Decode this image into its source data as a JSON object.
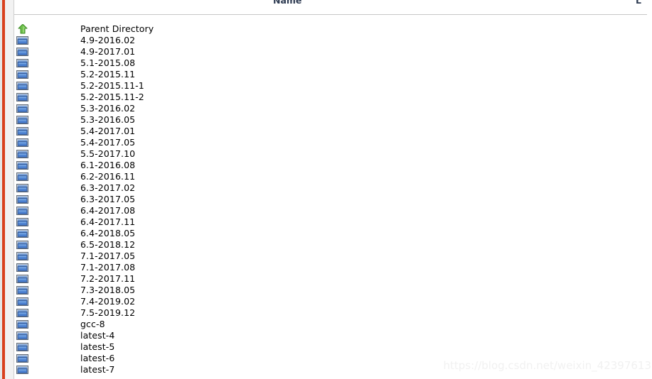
{
  "page": {
    "background_color": "#ffffff",
    "text_color": "#2f3640",
    "accent_color": "#d9411e",
    "rule_color": "#c6c6c6"
  },
  "columns": {
    "name_label": "Name",
    "last_modified_label": "L"
  },
  "listing": {
    "entries": [
      {
        "icon": "parent-directory-icon",
        "name": "Parent Directory"
      },
      {
        "icon": "folder-icon",
        "name": "4.9-2016.02"
      },
      {
        "icon": "folder-icon",
        "name": "4.9-2017.01"
      },
      {
        "icon": "folder-icon",
        "name": "5.1-2015.08"
      },
      {
        "icon": "folder-icon",
        "name": "5.2-2015.11"
      },
      {
        "icon": "folder-icon",
        "name": "5.2-2015.11-1"
      },
      {
        "icon": "folder-icon",
        "name": "5.2-2015.11-2"
      },
      {
        "icon": "folder-icon",
        "name": "5.3-2016.02"
      },
      {
        "icon": "folder-icon",
        "name": "5.3-2016.05"
      },
      {
        "icon": "folder-icon",
        "name": "5.4-2017.01"
      },
      {
        "icon": "folder-icon",
        "name": "5.4-2017.05"
      },
      {
        "icon": "folder-icon",
        "name": "5.5-2017.10"
      },
      {
        "icon": "folder-icon",
        "name": "6.1-2016.08"
      },
      {
        "icon": "folder-icon",
        "name": "6.2-2016.11"
      },
      {
        "icon": "folder-icon",
        "name": "6.3-2017.02"
      },
      {
        "icon": "folder-icon",
        "name": "6.3-2017.05"
      },
      {
        "icon": "folder-icon",
        "name": "6.4-2017.08"
      },
      {
        "icon": "folder-icon",
        "name": "6.4-2017.11"
      },
      {
        "icon": "folder-icon",
        "name": "6.4-2018.05"
      },
      {
        "icon": "folder-icon",
        "name": "6.5-2018.12"
      },
      {
        "icon": "folder-icon",
        "name": "7.1-2017.05"
      },
      {
        "icon": "folder-icon",
        "name": "7.1-2017.08"
      },
      {
        "icon": "folder-icon",
        "name": "7.2-2017.11"
      },
      {
        "icon": "folder-icon",
        "name": "7.3-2018.05"
      },
      {
        "icon": "folder-icon",
        "name": "7.4-2019.02"
      },
      {
        "icon": "folder-icon",
        "name": "7.5-2019.12"
      },
      {
        "icon": "folder-icon",
        "name": "gcc-8"
      },
      {
        "icon": "folder-icon",
        "name": "latest-4"
      },
      {
        "icon": "folder-icon",
        "name": "latest-5"
      },
      {
        "icon": "folder-icon",
        "name": "latest-6"
      },
      {
        "icon": "folder-icon",
        "name": "latest-7"
      }
    ]
  },
  "watermark": {
    "text": "https://blog.csdn.net/weixin_42397613"
  }
}
